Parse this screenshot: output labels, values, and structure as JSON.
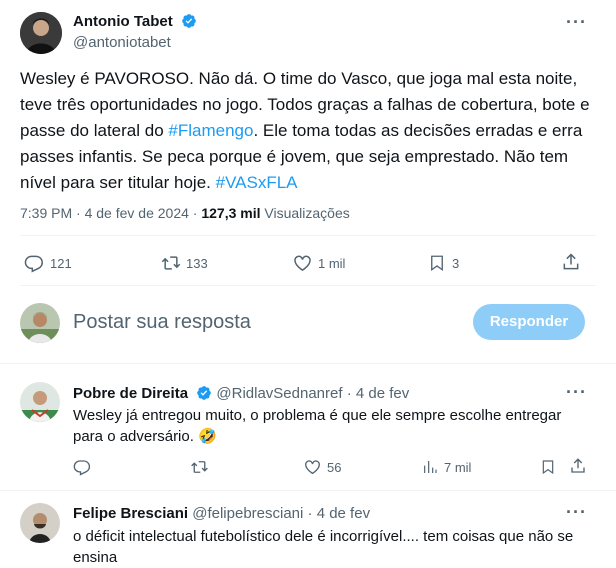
{
  "main_tweet": {
    "author_name": "Antonio Tabet",
    "author_handle": "@antoniotabet",
    "text_before_tag1": "Wesley é PAVOROSO. Não dá. O time do Vasco, que joga mal esta noite, teve três oportunidades no jogo. Todos graças a falhas de cobertura, bote e passe do lateral do ",
    "hashtag1": "#Flamengo",
    "text_after_tag1": ". Ele toma todas as decisões erradas e erra passes infantis. Se peca porque é jovem, que seja emprestado. Não tem nível para ser titular hoje. ",
    "hashtag2": "#VASxFLA",
    "time": "7:39 PM · 4 de fev de 2024 · ",
    "views_count": "127,3 mil",
    "views_label": " Visualizações",
    "replies": "121",
    "retweets": "133",
    "likes": "1 mil",
    "bookmarks": "3"
  },
  "compose": {
    "placeholder": "Postar sua resposta",
    "reply_button": "Responder"
  },
  "replies": [
    {
      "author_name": "Pobre de Direita",
      "author_handle": "@RidlavSednanref",
      "date": "· 4 de fev",
      "text": "Wesley já entregou muito, o problema é que ele sempre escolhe entregar para o adversário. 🤣",
      "likes": "56",
      "views": "7 mil"
    },
    {
      "author_name": "Felipe Bresciani",
      "author_handle": "@felipebresciani",
      "date": "· 4 de fev",
      "text": "o déficit intelectual futebolístico dele é incorrigível.... tem coisas que não se ensina"
    }
  ],
  "colors": {
    "accent": "#1d9bf0",
    "button_disabled": "#8ecdf8",
    "muted": "#536471"
  }
}
